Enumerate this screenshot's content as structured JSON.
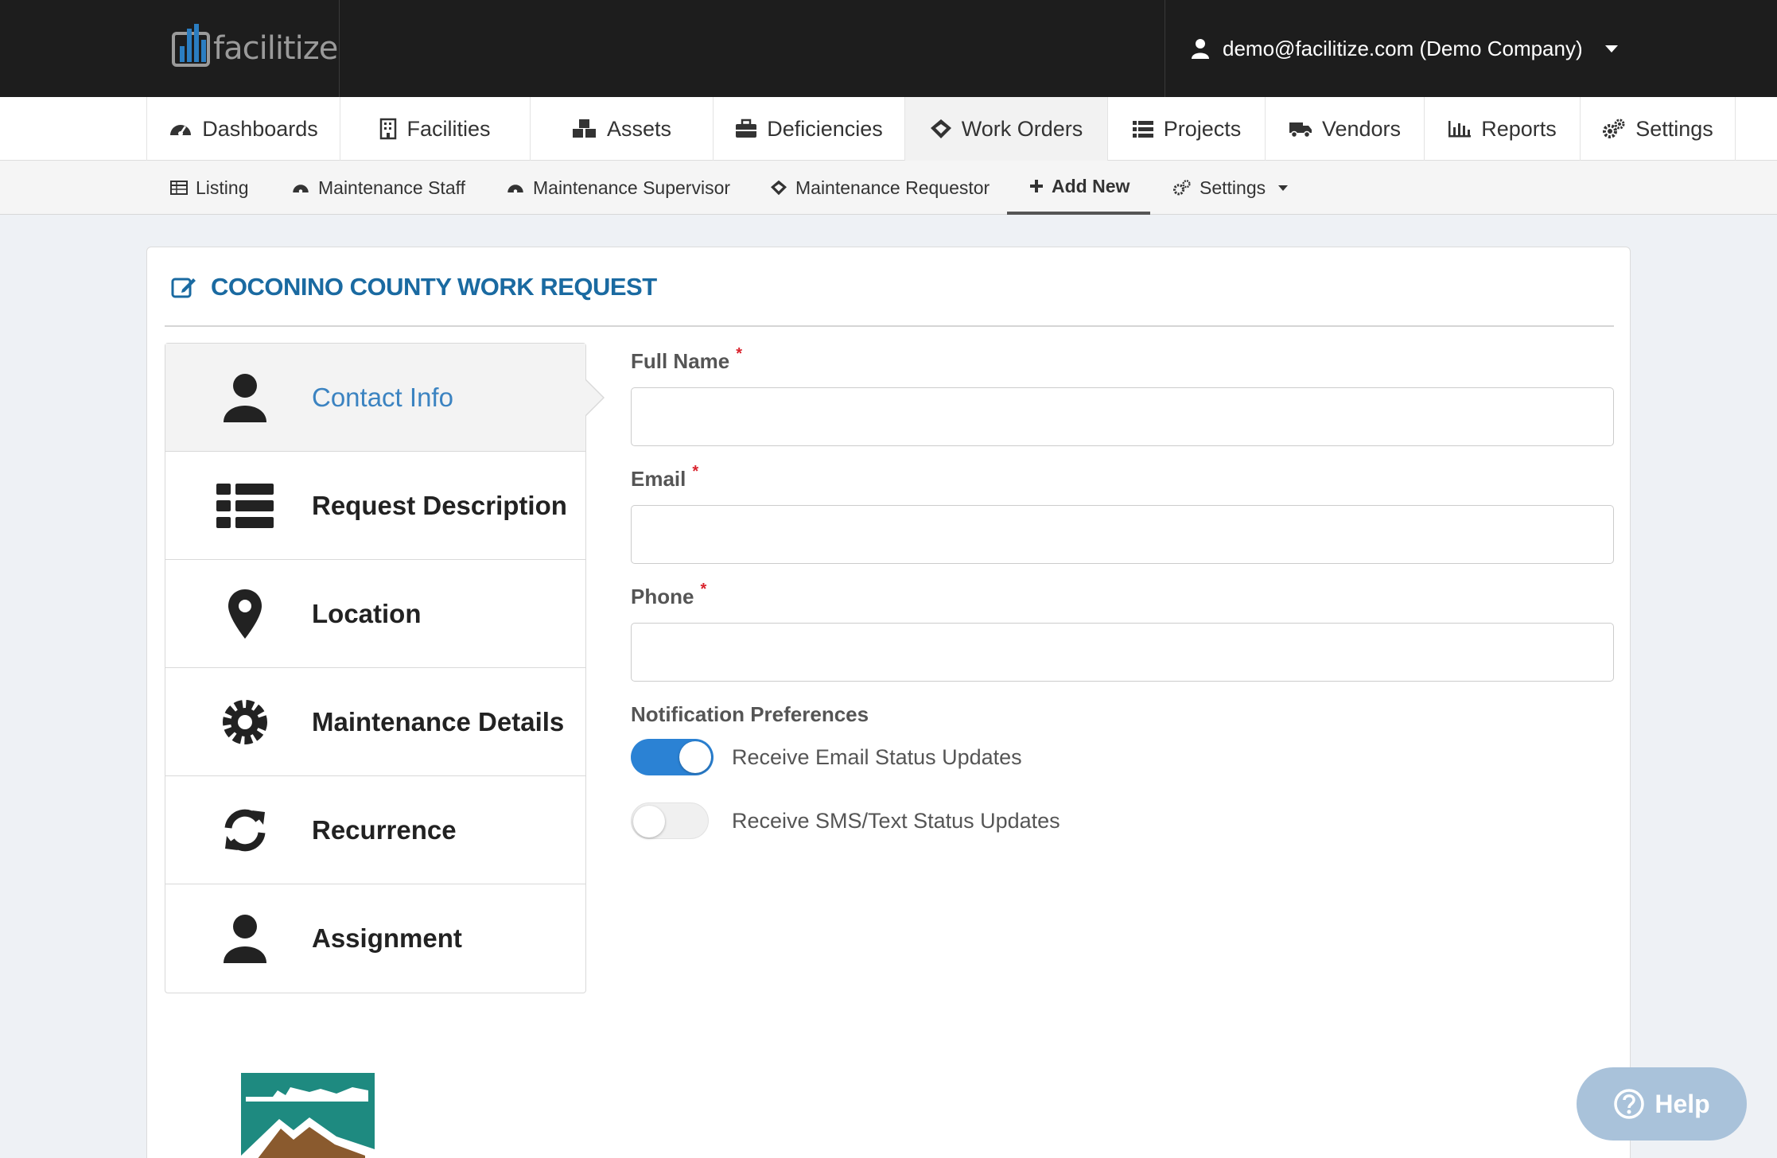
{
  "header": {
    "brand": "facilitize",
    "user_label": "demo@facilitize.com (Demo Company)"
  },
  "main_nav": [
    {
      "label": "Dashboards",
      "icon": "dashboard-icon"
    },
    {
      "label": "Facilities",
      "icon": "building-icon"
    },
    {
      "label": "Assets",
      "icon": "cubes-icon"
    },
    {
      "label": "Deficiencies",
      "icon": "briefcase-icon"
    },
    {
      "label": "Work Orders",
      "icon": "ticket-icon",
      "active": true
    },
    {
      "label": "Projects",
      "icon": "list-icon"
    },
    {
      "label": "Vendors",
      "icon": "truck-icon"
    },
    {
      "label": "Reports",
      "icon": "bar-chart-icon"
    },
    {
      "label": "Settings",
      "icon": "gears-icon"
    }
  ],
  "sub_nav": [
    {
      "label": "Listing",
      "icon": "table-icon"
    },
    {
      "label": "Maintenance Staff",
      "icon": "dashboard-icon"
    },
    {
      "label": "Maintenance Supervisor",
      "icon": "dashboard-icon"
    },
    {
      "label": "Maintenance Requestor",
      "icon": "ticket-icon"
    },
    {
      "label": "Add New",
      "icon": "plus-icon",
      "active": true
    },
    {
      "label": "Settings",
      "icon": "gears-icon"
    }
  ],
  "card": {
    "title": "COCONINO COUNTY WORK REQUEST"
  },
  "steps": [
    {
      "label": "Contact Info",
      "icon": "user-icon",
      "active": true
    },
    {
      "label": "Request Description",
      "icon": "list-icon"
    },
    {
      "label": "Location",
      "icon": "map-marker-icon"
    },
    {
      "label": "Maintenance Details",
      "icon": "gear-icon"
    },
    {
      "label": "Recurrence",
      "icon": "refresh-icon"
    },
    {
      "label": "Assignment",
      "icon": "user-icon"
    }
  ],
  "form": {
    "full_name": {
      "label": "Full Name",
      "required_mark": "*",
      "value": ""
    },
    "email": {
      "label": "Email",
      "required_mark": "*",
      "value": ""
    },
    "phone": {
      "label": "Phone",
      "required_mark": "*",
      "value": ""
    },
    "notification_title": "Notification Preferences",
    "email_updates": {
      "label": "Receive Email Status Updates",
      "enabled": true
    },
    "sms_updates": {
      "label": "Receive SMS/Text Status Updates",
      "enabled": false
    }
  },
  "help": {
    "label": "Help"
  },
  "colors": {
    "topbar": "#1d1d1d",
    "accent": "#1a6aa1",
    "active_step": "#3b83c1",
    "toggle_on": "#2b82d4",
    "required": "#d9232d",
    "help_button": "#a9c2da"
  }
}
